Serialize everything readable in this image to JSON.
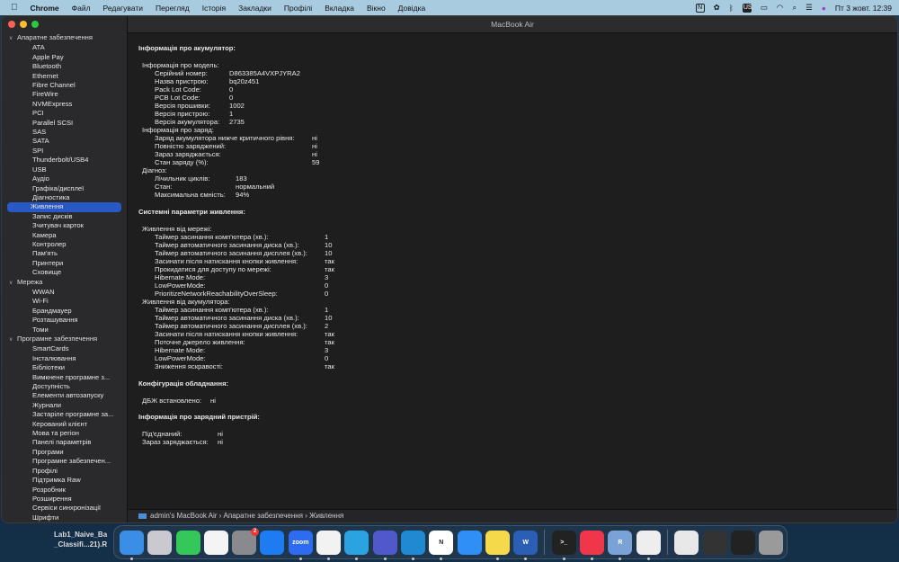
{
  "menubar": {
    "app": "Chrome",
    "items": [
      "Файл",
      "Редагувати",
      "Перегляд",
      "Історія",
      "Закладки",
      "Профілі",
      "Вкладка",
      "Вікно",
      "Довідка"
    ],
    "status_icons": [
      "notion-icon",
      "extension-icon",
      "bluetooth-icon",
      "keyboard-layout-icon",
      "battery-icon",
      "wifi-icon",
      "search-icon",
      "control-center-icon",
      "siri-icon"
    ],
    "keyboard_layout": "US",
    "datetime": "Пт 3 жовт.  12:39"
  },
  "window": {
    "title": "MacBook Air"
  },
  "sidebar": [
    {
      "label": "Апаратне забезпечення",
      "items": [
        "ATA",
        "Apple Pay",
        "Bluetooth",
        "Ethernet",
        "Fibre Channel",
        "FireWire",
        "NVMExpress",
        "PCI",
        "Parallel SCSI",
        "SAS",
        "SATA",
        "SPI",
        "Thunderbolt/USB4",
        "USB",
        "Аудіо",
        "Графіка/дисплеї",
        "Діагностика",
        "Живлення",
        "Запис дисків",
        "Зчитувач карток",
        "Камера",
        "Контролер",
        "Пам'ять",
        "Принтери",
        "Сховище"
      ]
    },
    {
      "label": "Мережа",
      "items": [
        "WWAN",
        "Wi-Fi",
        "Брандмауер",
        "Розташування",
        "Томи"
      ]
    },
    {
      "label": "Програмне забезпечення",
      "items": [
        "SmartCards",
        "Інсталювання",
        "Бібліотеки",
        "Вимкнене програмне з...",
        "Доступність",
        "Елементи автозапуску",
        "Журнали",
        "Застаріле програмне за...",
        "Керований клієнт",
        "Мова та регіон",
        "Панелі параметрів",
        "Програми",
        "Програмне забезпечен...",
        "Профілі",
        "Підтримка Raw",
        "Розробник",
        "Розширення",
        "Сервіси синхронізації",
        "Шрифти"
      ]
    }
  ],
  "selected_item": "Живлення",
  "content": {
    "battery_title": "Інформація про акумулятор:",
    "model_label": "Інформація про модель:",
    "model": [
      [
        "Серійний номер:",
        "D863385A4VXPJYRA2"
      ],
      [
        "Назва пристрою:",
        "bq20z451"
      ],
      [
        "Pack Lot Code:",
        "0"
      ],
      [
        "PCB Lot Code:",
        "0"
      ],
      [
        "Версія прошивки:",
        "1002"
      ],
      [
        "Версія пристрою:",
        "1"
      ],
      [
        "Версія акумулятора:",
        "2735"
      ]
    ],
    "charge_label": "Інформація про заряд:",
    "charge": [
      [
        "Заряд акумулятора нижче критичного рівня:",
        "ні"
      ],
      [
        "Повністю заряджений:",
        "ні"
      ],
      [
        "Зараз заряджається:",
        "ні"
      ],
      [
        "Стан заряду (%):",
        "59"
      ]
    ],
    "diag_label": "Діагноз:",
    "diag": [
      [
        "Лічильник циклів:",
        "183"
      ],
      [
        "Стан:",
        "нормальний"
      ],
      [
        "Максимальна ємність:",
        "94%"
      ]
    ],
    "power_title": "Системні параметри живлення:",
    "ac_label": "Живлення від мережі:",
    "ac": [
      [
        "Таймер засинання комп'ютера (хв.):",
        "1"
      ],
      [
        "Таймер автоматичного засинання диска (хв.):",
        "10"
      ],
      [
        "Таймер автоматичного засинання дисплея (хв.):",
        "10"
      ],
      [
        "Засинати після натискання кнопки живлення:",
        "так"
      ],
      [
        "Прокидатися для доступу по мережі:",
        "так"
      ],
      [
        "Hibernate Mode:",
        "3"
      ],
      [
        "LowPowerMode:",
        "0"
      ],
      [
        "PrioritizeNetworkReachabilityOverSleep:",
        "0"
      ]
    ],
    "batt_label": "Живлення від акумулятора:",
    "batt": [
      [
        "Таймер засинання комп'ютера (хв.):",
        "1"
      ],
      [
        "Таймер автоматичного засинання диска (хв.):",
        "10"
      ],
      [
        "Таймер автоматичного засинання дисплея (хв.):",
        "2"
      ],
      [
        "Засинати після натискання кнопки живлення:",
        "так"
      ],
      [
        "Поточне джерело живлення:",
        "так"
      ],
      [
        "Hibernate Mode:",
        "3"
      ],
      [
        "LowPowerMode:",
        "0"
      ],
      [
        "Зниження яскравості:",
        "так"
      ]
    ],
    "hw_title": "Конфігурація обладнання:",
    "ups": [
      "ДБЖ встановлено:",
      "ні"
    ],
    "charger_title": "Інформація про зарядний пристрій:",
    "charger": [
      [
        "Під'єднаний:",
        "ні"
      ],
      [
        "Зараз заряджається:",
        "ні"
      ]
    ]
  },
  "statusbar": {
    "path": "admin's MacBook Air › Апаратне забезпечення › Живлення"
  },
  "desktop_file": {
    "line1": "Lab1_Naive_Ba",
    "line2": "_Classifi...21).R"
  },
  "dock": [
    {
      "name": "finder",
      "color": "#3a8ee6",
      "running": true
    },
    {
      "name": "launchpad",
      "color": "#c9c9cf",
      "running": false
    },
    {
      "name": "messages",
      "color": "#34c759",
      "running": false
    },
    {
      "name": "photos",
      "color": "#f4f4f4",
      "running": false
    },
    {
      "name": "system-settings",
      "color": "#8a8a8e",
      "running": false,
      "badge": "2"
    },
    {
      "name": "app-store",
      "color": "#1e7cf2",
      "running": false
    },
    {
      "name": "zoom",
      "color": "#2d6cf0",
      "running": true,
      "label": "zoom"
    },
    {
      "name": "chrome",
      "color": "#f2f2f2",
      "running": true
    },
    {
      "name": "telegram",
      "color": "#2aa3e0",
      "running": true
    },
    {
      "name": "teams",
      "color": "#5059c9",
      "running": true
    },
    {
      "name": "vscode",
      "color": "#1f8ad2",
      "running": true
    },
    {
      "name": "notion",
      "color": "#ffffff",
      "running": true,
      "label": "N"
    },
    {
      "name": "safari",
      "color": "#2f8ff5",
      "running": false
    },
    {
      "name": "notes",
      "color": "#f6d84b",
      "running": true
    },
    {
      "name": "word",
      "color": "#2b5fb5",
      "running": true,
      "label": "W"
    },
    {
      "sep": true
    },
    {
      "name": "terminal",
      "color": "#222",
      "running": true,
      "label": ">_"
    },
    {
      "name": "music",
      "color": "#f0364a",
      "running": true
    },
    {
      "name": "r",
      "color": "#7aa2d6",
      "running": true,
      "label": "R"
    },
    {
      "name": "system-information",
      "color": "#eee",
      "running": true
    },
    {
      "sep": true
    },
    {
      "name": "document",
      "color": "#e8e8e8",
      "running": false
    },
    {
      "name": "vscode-window",
      "color": "#333",
      "running": false
    },
    {
      "name": "finder-window",
      "color": "#222",
      "running": false
    },
    {
      "name": "trash",
      "color": "#9a9a9a",
      "running": false
    }
  ]
}
